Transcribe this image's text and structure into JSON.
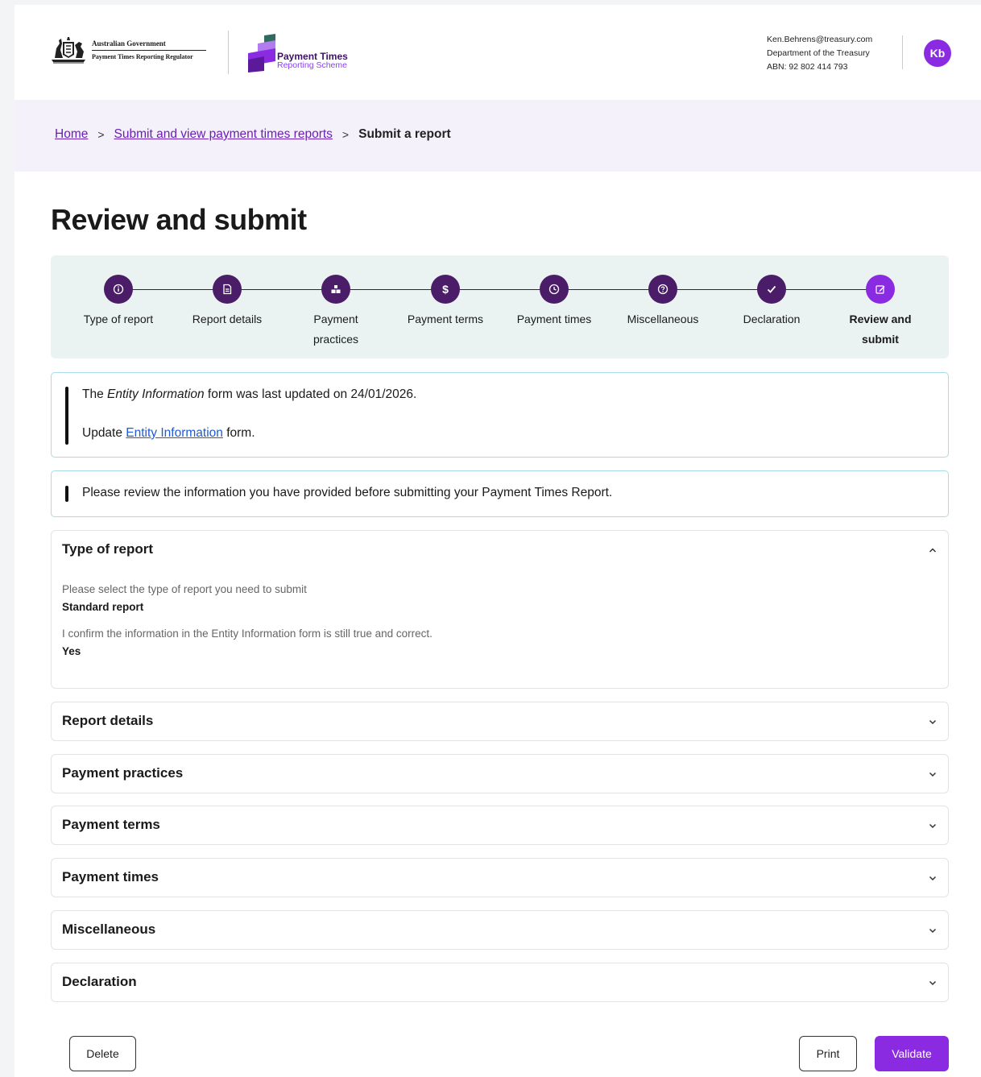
{
  "header": {
    "gov_name": "Australian Government",
    "gov_regulator": "Payment Times Reporting Regulator",
    "scheme_title": "Payment Times",
    "scheme_subtitle": "Reporting Scheme",
    "user_email": "Ken.Behrens@treasury.com",
    "user_department": "Department of the Treasury",
    "user_abn": "ABN: 92 802 414 793",
    "avatar_initials": "Kb"
  },
  "breadcrumb": {
    "home": "Home",
    "parent": "Submit and view payment times reports",
    "current": "Submit a report",
    "separator": ">"
  },
  "page_title": "Review and submit",
  "stepper": {
    "steps": [
      {
        "label": "Type of report",
        "icon": "info-icon"
      },
      {
        "label": "Report details",
        "icon": "document-icon"
      },
      {
        "label": "Payment practices",
        "icon": "blocks-icon"
      },
      {
        "label": "Payment terms",
        "icon": "dollar-icon"
      },
      {
        "label": "Payment times",
        "icon": "clock-icon"
      },
      {
        "label": "Miscellaneous",
        "icon": "question-icon"
      },
      {
        "label": "Declaration",
        "icon": "check-icon"
      },
      {
        "label": "Review and submit",
        "icon": "edit-icon"
      }
    ],
    "active_index": 7,
    "colors": {
      "completed": "#4b1d69",
      "active": "#8a2be2"
    }
  },
  "alerts": {
    "entity": {
      "line1_pre": "The ",
      "line1_em": "Entity Information",
      "line1_post": " form was last updated on 24/01/2026.",
      "line2_pre": "Update ",
      "line2_link": "Entity Information",
      "line2_post": " form."
    },
    "review": "Please review the information you have provided before submitting your Payment Times Report."
  },
  "accordions": {
    "type_of_report": {
      "title": "Type of report",
      "expanded": true,
      "q1": "Please select the type of report you need to submit",
      "a1": "Standard report",
      "q2": "I confirm the information in the Entity Information form is still true and correct.",
      "a2": "Yes"
    },
    "report_details": {
      "title": "Report details"
    },
    "payment_practices": {
      "title": "Payment practices"
    },
    "payment_terms": {
      "title": "Payment terms"
    },
    "payment_times": {
      "title": "Payment times"
    },
    "miscellaneous": {
      "title": "Miscellaneous"
    },
    "declaration": {
      "title": "Declaration"
    }
  },
  "actions": {
    "delete": "Delete",
    "print": "Print",
    "validate": "Validate"
  },
  "colors": {
    "accent": "#8a2be2",
    "dark_purple": "#4b1d69",
    "link": "#6a1fb5",
    "info_link": "#1f5ad6",
    "alert_border": "#a7dce8",
    "stepper_bg": "#eaf3f2",
    "breadcrumb_bg": "#f4f1fa"
  }
}
